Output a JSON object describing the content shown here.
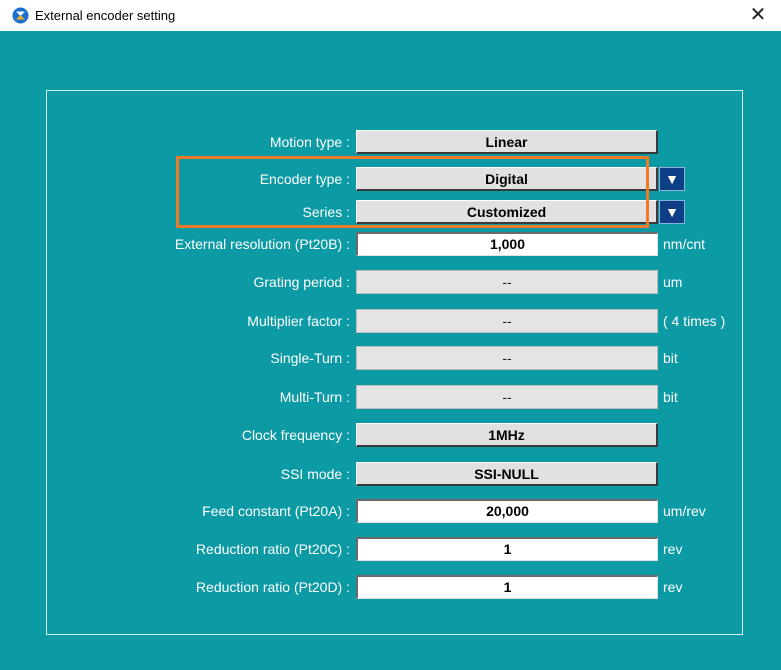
{
  "window": {
    "title": "External encoder setting",
    "close_glyph": "✕"
  },
  "fields": {
    "motion_type": {
      "label": "Motion type :",
      "value": "Linear"
    },
    "encoder_type": {
      "label": "Encoder type :",
      "value": "Digital"
    },
    "series": {
      "label": "Series :",
      "value": "Customized"
    },
    "external_resolution": {
      "label": "External resolution (Pt20B) :",
      "value": "1,000",
      "unit": "nm/cnt"
    },
    "grating_period": {
      "label": "Grating period :",
      "value": "--",
      "unit": "um"
    },
    "multiplier_factor": {
      "label": "Multiplier factor :",
      "value": "--",
      "unit": "( 4 times )"
    },
    "single_turn": {
      "label": "Single-Turn :",
      "value": "--",
      "unit": "bit"
    },
    "multi_turn": {
      "label": "Multi-Turn :",
      "value": "--",
      "unit": "bit"
    },
    "clock_frequency": {
      "label": "Clock frequency :",
      "value": "1MHz"
    },
    "ssi_mode": {
      "label": "SSI mode :",
      "value": "SSI-NULL"
    },
    "feed_constant": {
      "label": "Feed constant (Pt20A) :",
      "value": "20,000",
      "unit": "um/rev"
    },
    "reduction_ratio_c": {
      "label": "Reduction ratio (Pt20C) :",
      "value": "1",
      "unit": "rev"
    },
    "reduction_ratio_d": {
      "label": "Reduction ratio (Pt20D) :",
      "value": "1",
      "unit": "rev"
    }
  },
  "dropdown_glyph": "▼",
  "colors": {
    "client_background": "#0c9aa5",
    "dropdown_button": "#0c3f86",
    "highlight_border": "#ef7b26"
  },
  "icons": {
    "app": "app-logo-icon",
    "close": "close-icon",
    "dropdown": "triangle-down-icon"
  }
}
